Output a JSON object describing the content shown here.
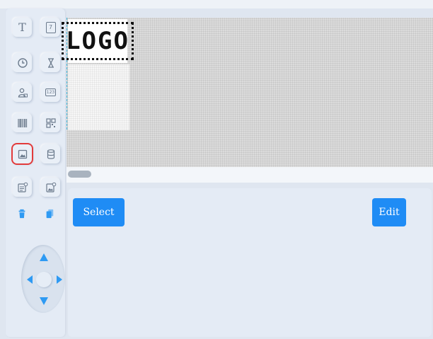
{
  "toolbar": {
    "rows": [
      [
        "text-tool",
        "calendar-tool"
      ],
      [
        "clock-tool",
        "hourglass-tool"
      ],
      [
        "user-tool",
        "counter-tool"
      ],
      [
        "barcode-tool",
        "qrcode-tool"
      ],
      [
        "image-tool",
        "database-tool"
      ],
      [
        "text-template-tool",
        "image-template-tool"
      ]
    ],
    "selected": "image-tool",
    "text_glyph": "T",
    "counter_glyph": "123",
    "calendar_glyph": "7"
  },
  "actions": [
    "delete-icon",
    "copy-icon"
  ],
  "dpad": [
    "up",
    "down",
    "left",
    "right"
  ],
  "canvas": {
    "logo_text": "LOGO"
  },
  "buttons": {
    "select_label": "Select",
    "edit_label": "Edit"
  },
  "colors": {
    "accent": "#1f8cf5",
    "arrow": "#2e9af3",
    "selected_outline": "#e23b3b"
  }
}
